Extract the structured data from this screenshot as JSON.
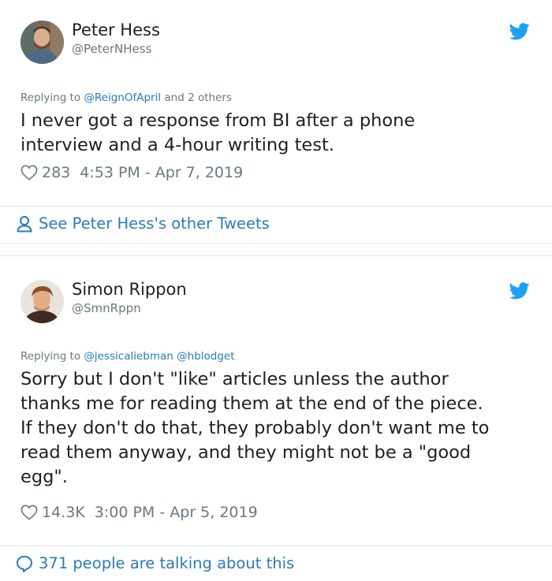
{
  "tweets": [
    {
      "name": "Peter Hess",
      "handle": "@PeterNHess",
      "replying_prefix": "Replying to ",
      "replying_to": "@ReignOfApril",
      "replying_suffix": " and 2 others",
      "text": "I never got a response from BI after a phone\ninterview and a 4-hour writing test.",
      "likes": "283",
      "timestamp": "4:53 PM - Apr 7, 2019",
      "avatar": "avatar-peter-hess"
    },
    {
      "name": "Simon Rippon",
      "handle": "@SmnRppn",
      "replying_prefix": "Replying to ",
      "replying_to": "@jessicaliebman",
      "replying_suffix": " @hblodget",
      "text": "Sorry but I don't \"like\" articles unless the author\nthanks me for reading them at the end of the piece.\nIf they don't do that, they probably don't want me to\nread them anyway, and they might not be a \"good\negg\".",
      "likes": "14.3K",
      "timestamp": "3:00 PM - Apr 5, 2019",
      "avatar": "avatar-simon-rippon"
    }
  ],
  "links": {
    "see_other": "See Peter Hess's other Tweets",
    "talking": "371 people are talking about this"
  },
  "icons": {
    "brand": "twitter-bird-icon",
    "like": "heart-icon",
    "profile": "person-icon",
    "reply": "speech-bubble-icon"
  },
  "colors": {
    "brand": "#1da1f2",
    "link": "#2b7bb9",
    "muted": "#697882",
    "text": "#1c2022",
    "divider": "#e1e8ed"
  }
}
